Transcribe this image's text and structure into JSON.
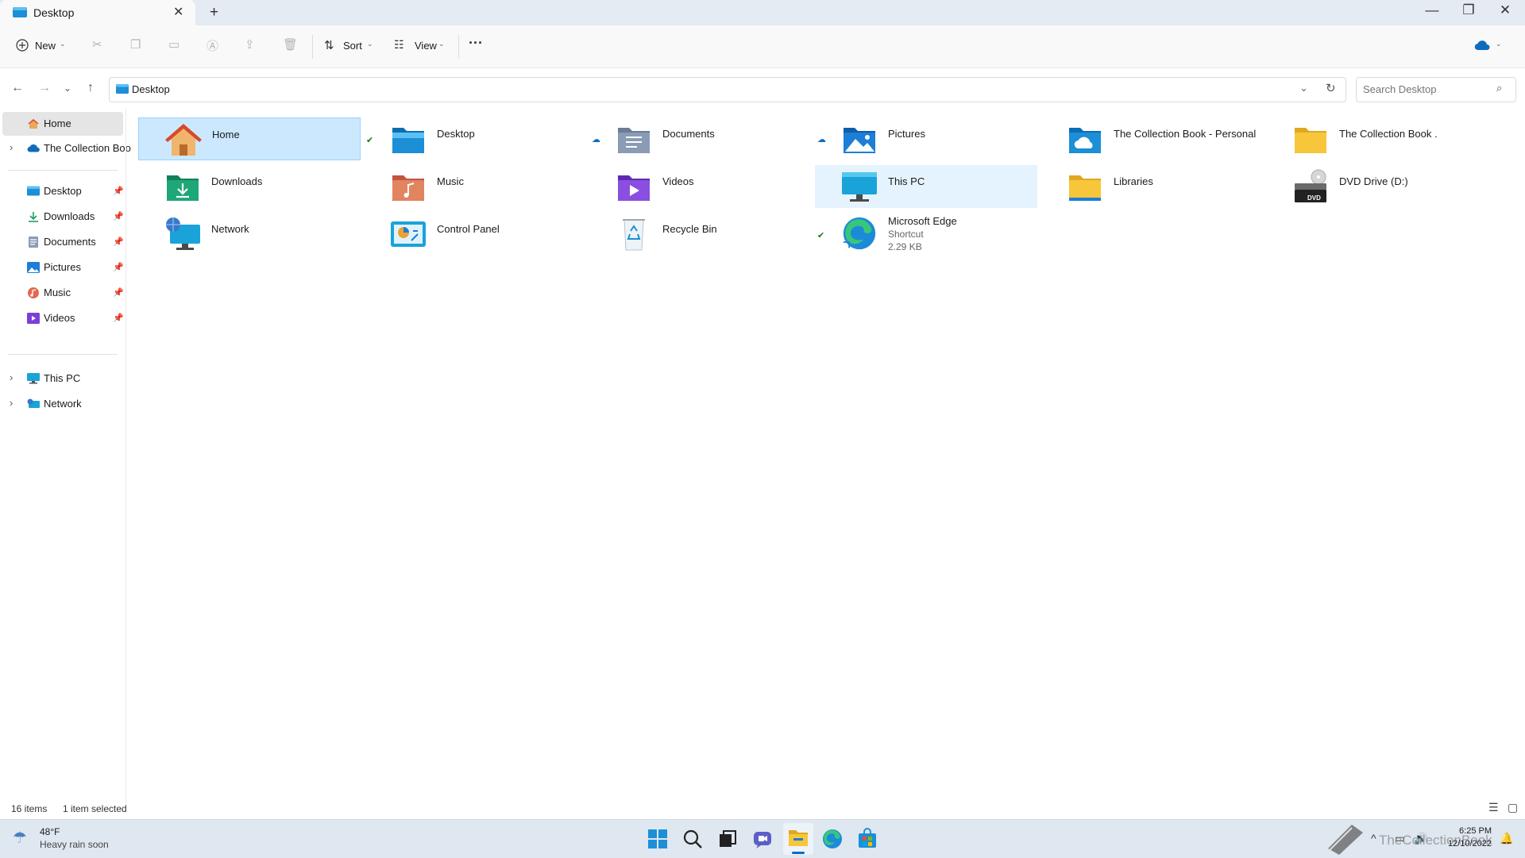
{
  "window": {
    "tab_title": "Desktop",
    "new_tab_symbol": "+",
    "close_tab_symbol": "✕",
    "controls": {
      "minimize": "—",
      "maximize": "❐",
      "close": "✕"
    }
  },
  "toolbar": {
    "new_label": "New",
    "sort_label": "Sort",
    "view_label": "View",
    "more_symbol": "···",
    "disabled_icons": [
      "cut-icon",
      "copy-icon",
      "paste-icon",
      "rename-icon",
      "share-icon",
      "delete-icon"
    ]
  },
  "address": {
    "path_label": "Desktop",
    "search_placeholder": "Search Desktop"
  },
  "sidebar": {
    "home": "Home",
    "onedrive": "The Collection Boo",
    "quick_access": [
      {
        "label": "Desktop",
        "icon": "desktop-icon"
      },
      {
        "label": "Downloads",
        "icon": "downloads-icon"
      },
      {
        "label": "Documents",
        "icon": "documents-icon"
      },
      {
        "label": "Pictures",
        "icon": "pictures-icon"
      },
      {
        "label": "Music",
        "icon": "music-icon"
      },
      {
        "label": "Videos",
        "icon": "videos-icon"
      }
    ],
    "this_pc": "This PC",
    "network": "Network"
  },
  "items": [
    {
      "name": "Home",
      "icon": "home-icon",
      "selected": true
    },
    {
      "name": "Desktop",
      "icon": "desktop-folder-icon",
      "sync": "available"
    },
    {
      "name": "Documents",
      "icon": "documents-folder-icon",
      "sync": "cloud"
    },
    {
      "name": "Pictures",
      "icon": "pictures-folder-icon",
      "sync": "cloud"
    },
    {
      "name": "The Collection Book - Personal",
      "icon": "onedrive-folder-icon"
    },
    {
      "name": "The Collection Book .",
      "icon": "yellow-folder-icon"
    },
    {
      "name": "Downloads",
      "icon": "downloads-folder-icon"
    },
    {
      "name": "Music",
      "icon": "music-folder-icon"
    },
    {
      "name": "Videos",
      "icon": "videos-folder-icon"
    },
    {
      "name": "This PC",
      "icon": "this-pc-icon",
      "hover": true
    },
    {
      "name": "Libraries",
      "icon": "libraries-folder-icon"
    },
    {
      "name": "DVD Drive (D:)",
      "icon": "dvd-drive-icon",
      "badge": "DVD"
    },
    {
      "name": "Network",
      "icon": "network-icon"
    },
    {
      "name": "Control Panel",
      "icon": "control-panel-icon"
    },
    {
      "name": "Recycle Bin",
      "icon": "recycle-bin-icon"
    },
    {
      "name": "Microsoft Edge",
      "icon": "edge-icon",
      "sync": "available",
      "type": "Shortcut",
      "size": "2.29 KB"
    }
  ],
  "status": {
    "count": "16 items",
    "selection": "1 item selected"
  },
  "taskbar": {
    "weather_temp": "48°F",
    "weather_desc": "Heavy rain soon",
    "time": "6:25 PM",
    "date": "12/10/2022",
    "watermark": "TheCollectionBook"
  },
  "colors": {
    "accent": "#0078d4",
    "selection": "#cce8ff",
    "folder_yellow": "#f8c63a",
    "sync_green": "#107c10"
  }
}
